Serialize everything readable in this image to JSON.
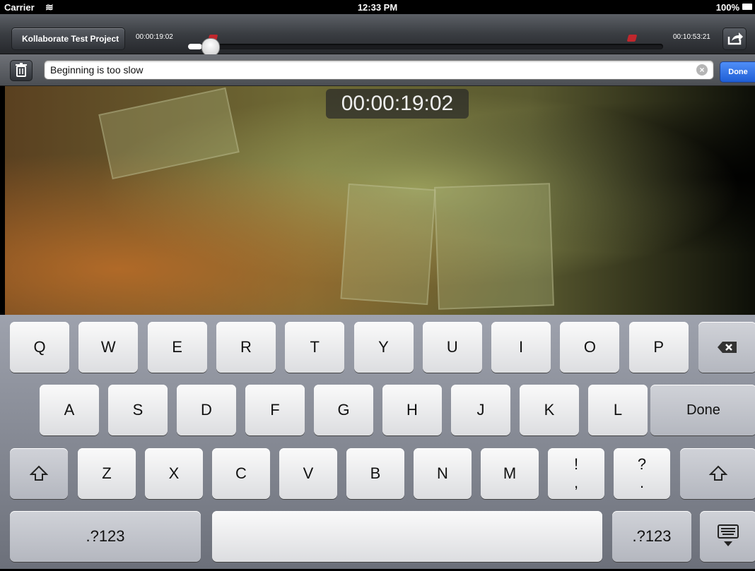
{
  "status_bar": {
    "carrier": "Carrier",
    "time": "12:33 PM",
    "battery": "100%"
  },
  "nav": {
    "back_label": "Kollaborate Test Project",
    "current_time": "00:00:19:02",
    "duration": "00:10:53:21",
    "playback_progress": 0.029,
    "comment_marker_positions": [
      0.029,
      0.91
    ]
  },
  "comment_bar": {
    "comment_text": "Beginning is too slow",
    "done_label": "Done"
  },
  "video": {
    "timecode_overlay": "00:00:19:02"
  },
  "keyboard": {
    "row1": [
      "Q",
      "W",
      "E",
      "R",
      "T",
      "Y",
      "U",
      "I",
      "O",
      "P"
    ],
    "row2": [
      "A",
      "S",
      "D",
      "F",
      "G",
      "H",
      "J",
      "K",
      "L"
    ],
    "row2_return": "Done",
    "row3": [
      "Z",
      "X",
      "C",
      "V",
      "B",
      "N",
      "M"
    ],
    "row3_punct": [
      {
        "top": "!",
        "bottom": ","
      },
      {
        "top": "?",
        "bottom": "."
      }
    ],
    "numbers_label": ".?123"
  },
  "colors": {
    "accent_blue": "#2a6ee8",
    "marker_red": "#c0272d"
  }
}
